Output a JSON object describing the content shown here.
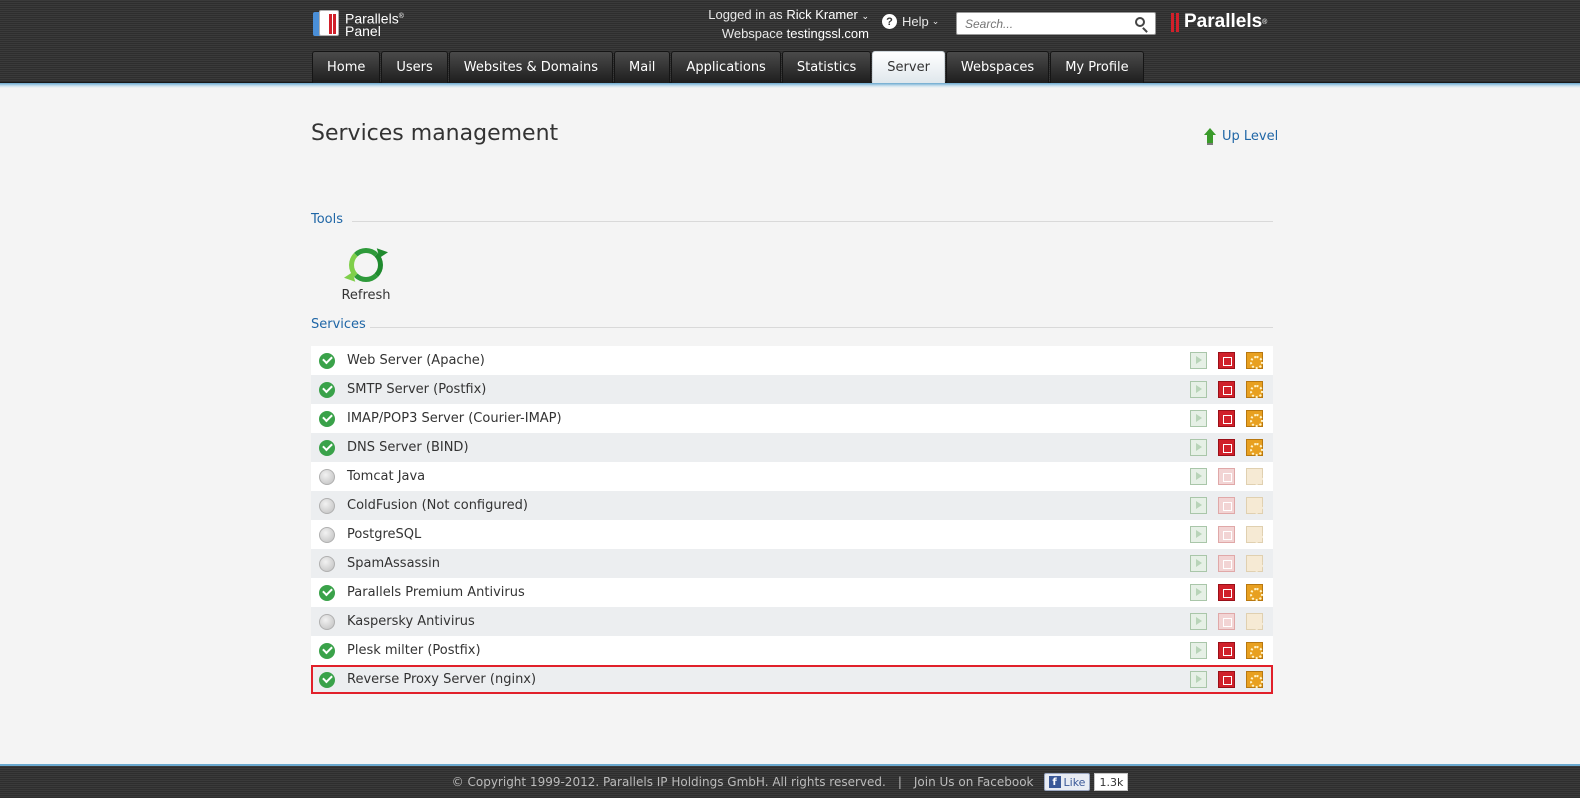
{
  "header": {
    "logo_line1": "Parallels",
    "logo_reg": "®",
    "logo_line2": "Panel",
    "logged_in_label": "Logged in as",
    "user_name": "Rick Kramer",
    "webspace_label": "Webspace",
    "webspace_value": "testingssl.com",
    "help_label": "Help",
    "search_placeholder": "Search...",
    "brand": "Parallels",
    "brand_reg": "®"
  },
  "nav": {
    "tabs": [
      {
        "label": "Home"
      },
      {
        "label": "Users"
      },
      {
        "label": "Websites & Domains"
      },
      {
        "label": "Mail"
      },
      {
        "label": "Applications"
      },
      {
        "label": "Statistics"
      },
      {
        "label": "Server",
        "active": true
      },
      {
        "label": "Webspaces"
      },
      {
        "label": "My Profile"
      }
    ]
  },
  "page": {
    "title": "Services management",
    "up_level": "Up Level"
  },
  "tools": {
    "title": "Tools",
    "refresh_label": "Refresh"
  },
  "services": {
    "title": "Services",
    "items": [
      {
        "name": "Web Server (Apache)",
        "running": true
      },
      {
        "name": "SMTP Server (Postfix)",
        "running": true
      },
      {
        "name": "IMAP/POP3 Server (Courier-IMAP)",
        "running": true
      },
      {
        "name": "DNS Server (BIND)",
        "running": true
      },
      {
        "name": "Tomcat Java",
        "running": false
      },
      {
        "name": "ColdFusion (Not configured)",
        "running": false
      },
      {
        "name": "PostgreSQL",
        "running": false
      },
      {
        "name": "SpamAssassin",
        "running": false
      },
      {
        "name": "Parallels Premium Antivirus",
        "running": true
      },
      {
        "name": "Kaspersky Antivirus",
        "running": false
      },
      {
        "name": "Plesk milter (Postfix)",
        "running": true
      },
      {
        "name": "Reverse Proxy Server (nginx)",
        "running": true,
        "highlighted": true
      }
    ]
  },
  "footer": {
    "copyright": "© Copyright 1999-2012. Parallels IP Holdings GmbH. All rights reserved.",
    "separator": "|",
    "facebook": "Join Us on Facebook",
    "like_label": "Like",
    "like_count": "1.3k"
  },
  "colors": {
    "accent_link": "#1f66a6",
    "running": "#3aa24a",
    "stop": "#d0202a",
    "restart": "#e8a020",
    "highlight_border": "#e1202a"
  }
}
